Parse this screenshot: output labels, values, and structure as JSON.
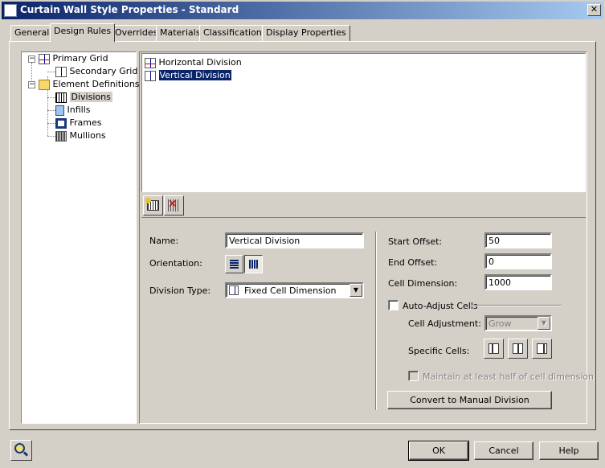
{
  "window": {
    "title": "Curtain Wall Style Properties - Standard",
    "close_glyph": "✕"
  },
  "tabs": [
    {
      "label": "General"
    },
    {
      "label": "Design Rules"
    },
    {
      "label": "Overrides"
    },
    {
      "label": "Materials"
    },
    {
      "label": "Classifications"
    },
    {
      "label": "Display Properties"
    }
  ],
  "tree": {
    "primary_grid": "Primary Grid",
    "secondary_grid": "Secondary Grid",
    "element_definitions": "Element Definitions",
    "divisions": "Divisions",
    "infills": "Infills",
    "frames": "Frames",
    "mullions": "Mullions"
  },
  "division_list": {
    "items": [
      {
        "label": "Horizontal Division"
      },
      {
        "label": "Vertical Division"
      }
    ]
  },
  "form": {
    "name_label": "Name:",
    "name_value": "Vertical Division",
    "orientation_label": "Orientation:",
    "division_type_label": "Division Type:",
    "division_type_value": "Fixed Cell Dimension",
    "start_offset_label": "Start Offset:",
    "start_offset_value": "50",
    "end_offset_label": "End Offset:",
    "end_offset_value": "0",
    "cell_dimension_label": "Cell Dimension:",
    "cell_dimension_value": "1000",
    "auto_adjust_label": "Auto-Adjust Cells",
    "cell_adjustment_label": "Cell Adjustment:",
    "cell_adjustment_value": "Grow",
    "specific_cells_label": "Specific Cells:",
    "maintain_label": "Maintain at least half of cell dimension",
    "convert_button": "Convert to Manual Division"
  },
  "footer": {
    "ok": "OK",
    "cancel": "Cancel",
    "help": "Help"
  }
}
